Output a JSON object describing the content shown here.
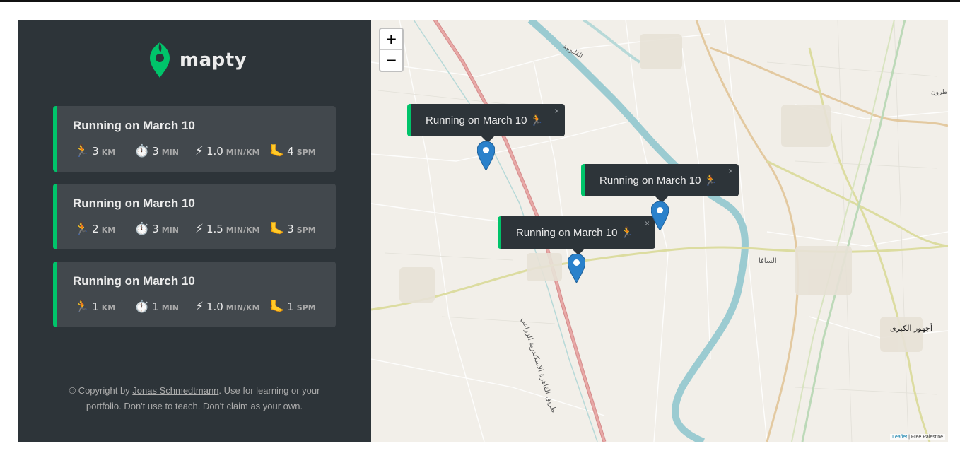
{
  "app": {
    "name": "mapty"
  },
  "workouts": [
    {
      "title": "Running on March 10",
      "icons": [
        "running-icon",
        "stopwatch-icon",
        "lightning-icon",
        "foot-icon"
      ],
      "distance": "3",
      "distance_unit": "km",
      "duration": "3",
      "duration_unit": "min",
      "pace": "1.0",
      "pace_unit": "min/km",
      "cadence": "4",
      "cadence_unit": "spm"
    },
    {
      "title": "Running on March 10",
      "distance": "2",
      "distance_unit": "km",
      "duration": "3",
      "duration_unit": "min",
      "pace": "1.5",
      "pace_unit": "min/km",
      "cadence": "3",
      "cadence_unit": "spm"
    },
    {
      "title": "Running on March 10",
      "distance": "1",
      "distance_unit": "km",
      "duration": "1",
      "duration_unit": "min",
      "pace": "1.0",
      "pace_unit": "min/km",
      "cadence": "1",
      "cadence_unit": "spm"
    }
  ],
  "emoji": {
    "running": "🏃",
    "stopwatch": "⏱️",
    "lightning": "⚡",
    "foot": "🦶"
  },
  "copyright": {
    "prefix": "© Copyright by ",
    "author": "Jonas Schmedtmann",
    "suffix": ". Use for learning or your portfolio. Don't use to teach. Don't claim as your own."
  },
  "map": {
    "zoom_in": "+",
    "zoom_out": "−",
    "popups": [
      {
        "text": "Running on March 10 🏃",
        "close": "×"
      },
      {
        "text": "Running on March 10 🏃",
        "close": "×"
      },
      {
        "text": "Running on March 10 🏃",
        "close": "×"
      }
    ],
    "labels": {
      "road": "طريق القاهرة الاسكندرية الزراعي",
      "village1": "السافا",
      "city": "أجهور الكبرى",
      "canal": "القليوبية",
      "edge": "طرون"
    },
    "attribution_leaflet": "Leaflet",
    "attribution_rest": " | Free Palestine"
  },
  "colors": {
    "accent": "#00c46a",
    "sidebar": "#2d3439",
    "card": "#42484d",
    "river": "#9bcbd1",
    "marker": "#2a81cb"
  }
}
